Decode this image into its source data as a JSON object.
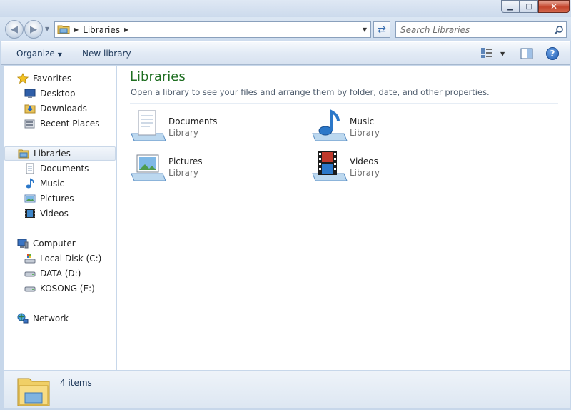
{
  "window": {
    "minimize_glyph": "▁",
    "maximize_glyph": "□",
    "close_glyph": "✕"
  },
  "address": {
    "breadcrumb": "Libraries",
    "search_placeholder": "Search Libraries"
  },
  "toolbar": {
    "organize_label": "Organize",
    "new_library_label": "New library"
  },
  "nav": {
    "favorites": {
      "label": "Favorites",
      "items": [
        {
          "label": "Desktop",
          "icon": "desktop-icon"
        },
        {
          "label": "Downloads",
          "icon": "downloads-icon"
        },
        {
          "label": "Recent Places",
          "icon": "recent-places-icon"
        }
      ]
    },
    "libraries": {
      "label": "Libraries",
      "items": [
        {
          "label": "Documents",
          "icon": "documents-icon"
        },
        {
          "label": "Music",
          "icon": "music-icon"
        },
        {
          "label": "Pictures",
          "icon": "pictures-icon"
        },
        {
          "label": "Videos",
          "icon": "videos-icon"
        }
      ]
    },
    "computer": {
      "label": "Computer",
      "items": [
        {
          "label": "Local Disk (C:)",
          "icon": "local-disk-icon"
        },
        {
          "label": "DATA (D:)",
          "icon": "drive-icon"
        },
        {
          "label": "KOSONG (E:)",
          "icon": "drive-icon"
        }
      ]
    },
    "network": {
      "label": "Network"
    }
  },
  "content": {
    "title": "Libraries",
    "subtitle": "Open a library to see your files and arrange them by folder, date, and other properties.",
    "libraries": [
      {
        "name": "Documents",
        "type": "Library",
        "icon": "documents-library-icon"
      },
      {
        "name": "Music",
        "type": "Library",
        "icon": "music-library-icon"
      },
      {
        "name": "Pictures",
        "type": "Library",
        "icon": "pictures-library-icon"
      },
      {
        "name": "Videos",
        "type": "Library",
        "icon": "videos-library-icon"
      }
    ]
  },
  "status": {
    "item_count": "4 items"
  },
  "colors": {
    "title_green": "#1e6e21",
    "link_blue": "#1e395b",
    "selection": "#e1e9f3"
  }
}
